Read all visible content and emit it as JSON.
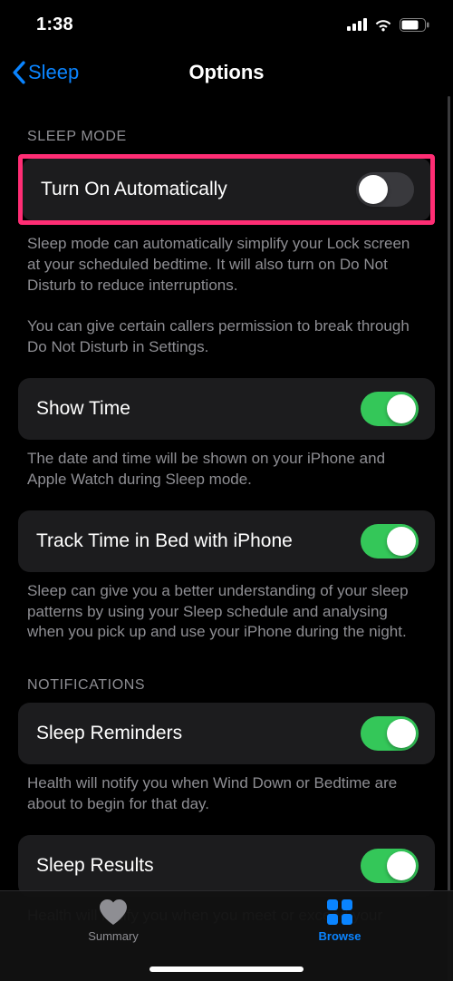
{
  "status": {
    "time": "1:38"
  },
  "nav": {
    "back_label": "Sleep",
    "title": "Options"
  },
  "sections": {
    "sleep_mode": {
      "header": "SLEEP MODE",
      "turn_on_auto": {
        "label": "Turn On Automatically",
        "on": false
      },
      "footer1": "Sleep mode can automatically simplify your Lock screen at your scheduled bedtime. It will also turn on Do Not Disturb to reduce interruptions.",
      "footer2": "You can give certain callers permission to break through Do Not Disturb in Settings.",
      "show_time": {
        "label": "Show Time",
        "on": true
      },
      "show_time_footer": "The date and time will be shown on your iPhone and Apple Watch during Sleep mode.",
      "track_time": {
        "label": "Track Time in Bed with iPhone",
        "on": true
      },
      "track_time_footer": "Sleep can give you a better understanding of your sleep patterns by using your Sleep schedule and analysing when you pick up and use your iPhone during the night."
    },
    "notifications": {
      "header": "NOTIFICATIONS",
      "sleep_reminders": {
        "label": "Sleep Reminders",
        "on": true
      },
      "sleep_reminders_footer": "Health will notify you when Wind Down or Bedtime are about to begin for that day.",
      "sleep_results": {
        "label": "Sleep Results",
        "on": true
      },
      "sleep_results_footer": "Health will notify you when you meet or exceed your"
    }
  },
  "tabs": {
    "summary": "Summary",
    "browse": "Browse"
  }
}
